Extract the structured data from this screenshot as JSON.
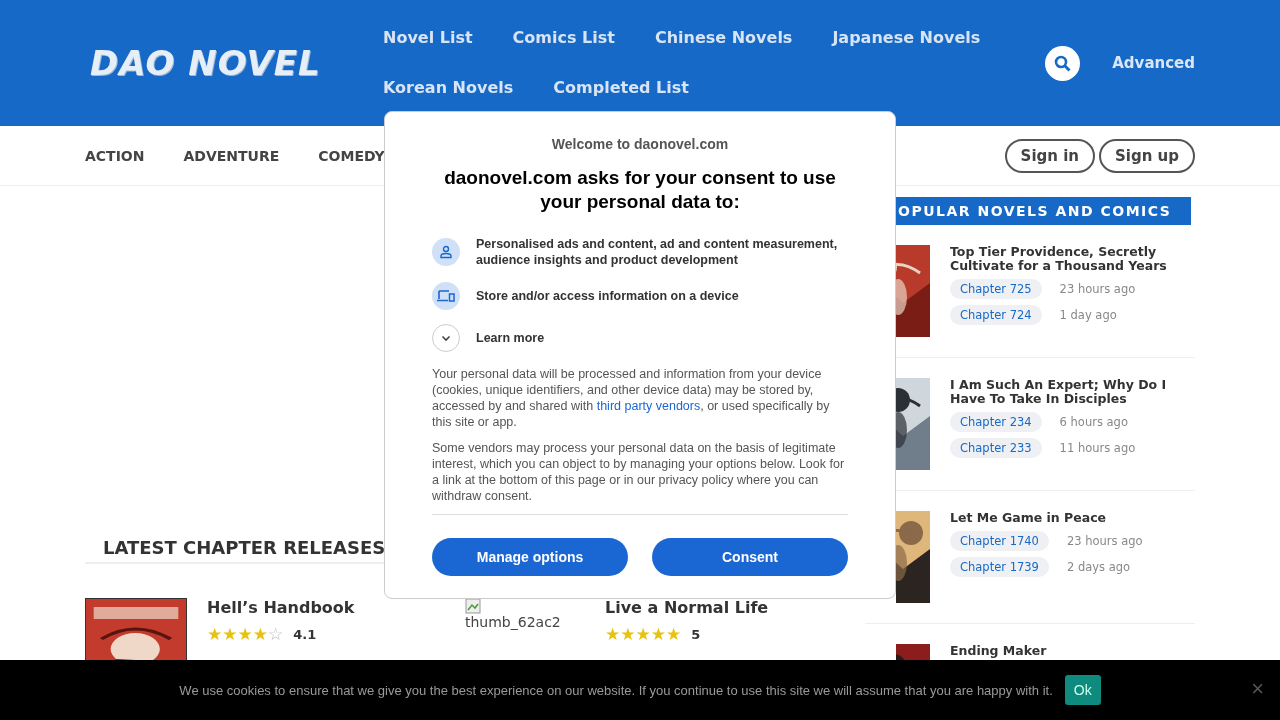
{
  "header": {
    "logo": "DAO NOVEL",
    "nav": [
      {
        "label": "Novel List"
      },
      {
        "label": "Comics List"
      },
      {
        "label": "Chinese Novels"
      },
      {
        "label": "Japanese Novels"
      },
      {
        "label": "Korean Novels"
      },
      {
        "label": "Completed List"
      }
    ],
    "advanced": "Advanced"
  },
  "genres": [
    "ACTION",
    "ADVENTURE",
    "COMEDY"
  ],
  "auth": [
    "Sign in",
    "Sign up"
  ],
  "latest": {
    "title": "LATEST CHAPTER RELEASES",
    "items": [
      {
        "kind": "cover",
        "title": "Hell’s Handbook",
        "stars": 4,
        "rating": "4.1"
      },
      {
        "kind": "broken",
        "alt": "thumb_62ac2",
        "title": "Live a Normal Life",
        "stars": 5,
        "rating": "5"
      }
    ]
  },
  "popular": {
    "title": "OPULAR NOVELS AND COMICS",
    "items": [
      {
        "title": "Top Tier Providence, Secretly Cultivate for a Thousand Years",
        "chapters": [
          {
            "label": "Chapter 725",
            "time": "23 hours ago"
          },
          {
            "label": "Chapter 724",
            "time": "1 day ago"
          }
        ]
      },
      {
        "title": "I Am Such An Expert; Why Do I Have To Take In Disciples",
        "chapters": [
          {
            "label": "Chapter 234",
            "time": "6 hours ago"
          },
          {
            "label": "Chapter 233",
            "time": "11 hours ago"
          }
        ]
      },
      {
        "title": "Let Me Game in Peace",
        "chapters": [
          {
            "label": "Chapter 1740",
            "time": "23 hours ago"
          },
          {
            "label": "Chapter 1739",
            "time": "2 days ago"
          }
        ]
      },
      {
        "title": "Ending Maker"
      }
    ]
  },
  "consent": {
    "welcome": "Welcome to daonovel.com",
    "heading": "daonovel.com asks for your consent to use your personal data to:",
    "purposes": [
      {
        "kind": "person",
        "text": "Personalised ads and content, ad and content measurement, audience insights and product development"
      },
      {
        "kind": "device",
        "text": "Store and/or access information on a device"
      },
      {
        "kind": "expand",
        "text": "Learn more"
      }
    ],
    "body1": "Your personal data will be processed and information from your device (cookies, unique identifiers, and other device data) may be stored by, accessed by and shared with ",
    "link": "third party vendors",
    "body1_end": ", or used specifically by this site or app.",
    "body2": "Some vendors may process your personal data on the basis of legitimate interest, which you can object to by managing your options below. Look for a link at the bottom of this page or in our privacy policy where you can withdraw consent.",
    "buttons": [
      "Manage options",
      "Consent"
    ]
  },
  "cookie_bar": {
    "text": "We use cookies to ensure that we give you the best experience on our website. If you continue to use this site we will assume that you are happy with it.",
    "ok": "Ok",
    "close": "×"
  }
}
